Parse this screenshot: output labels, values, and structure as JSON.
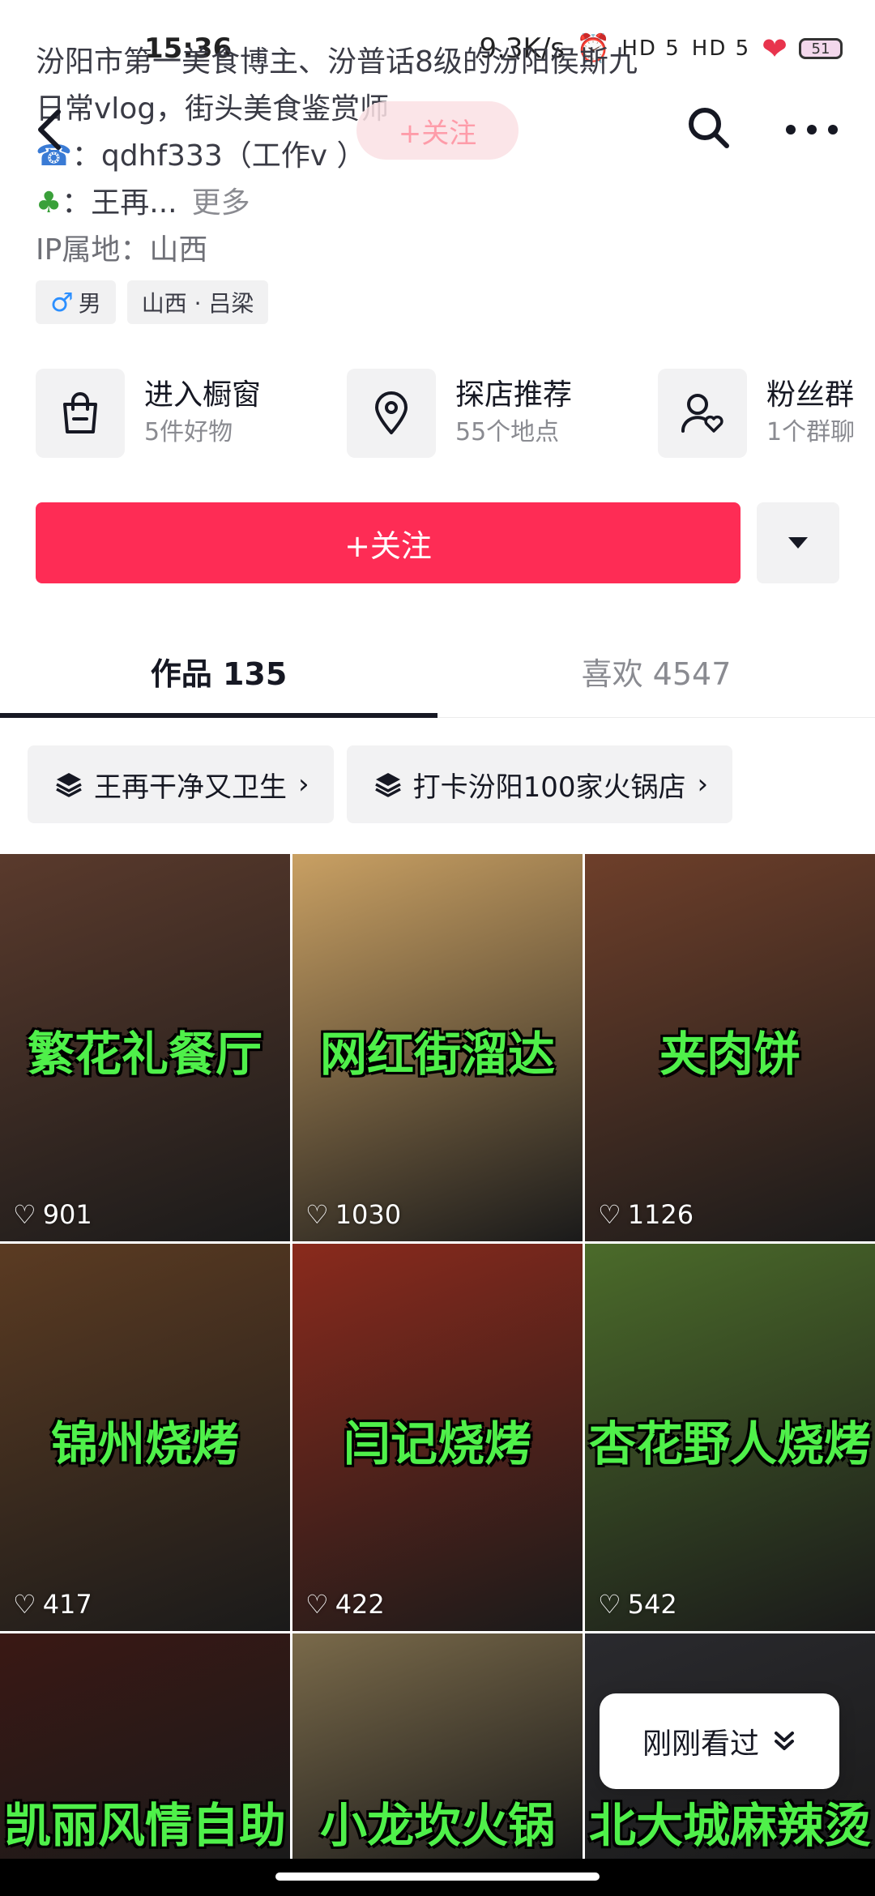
{
  "status_bar": {
    "time": "15:36",
    "network_speed": "9.3K/s",
    "signal_1": "HD 5",
    "signal_2": "HD 5",
    "battery": "51"
  },
  "header": {
    "follow_label": "+关注"
  },
  "bio": {
    "line1": "汾阳市第一美食博主、汾普话8级的汾阳侯斯九",
    "line2": "日常vlog，街头美食鉴赏师",
    "line3": "：qdhf333（工作v ）",
    "line4": "：王再...",
    "more": "更多",
    "ip": "IP属地：山西"
  },
  "tags": {
    "gender": "男",
    "location": "山西 · 吕梁"
  },
  "shortcuts": [
    {
      "title": "进入橱窗",
      "sub": "5件好物",
      "icon": "shopping-bag-icon"
    },
    {
      "title": "探店推荐",
      "sub": "55个地点",
      "icon": "location-pin-icon"
    },
    {
      "title": "粉丝群",
      "sub": "1个群聊",
      "icon": "fan-group-icon"
    }
  ],
  "follow_button": "+关注",
  "tabs": [
    {
      "label": "作品 135"
    },
    {
      "label": "喜欢 4547"
    }
  ],
  "collections": [
    {
      "label": "王再干净又卫生"
    },
    {
      "label": "打卡汾阳100家火锅店"
    }
  ],
  "videos": [
    {
      "caption": "繁花礼餐厅",
      "likes": "901",
      "color": "#5a3a2c"
    },
    {
      "caption": "网红街溜达",
      "likes": "1030",
      "color": "#c9a063"
    },
    {
      "caption": "夹肉饼",
      "likes": "1126",
      "color": "#6e3f2a"
    },
    {
      "caption": "锦州烧烤",
      "likes": "417",
      "color": "#5b3b22"
    },
    {
      "caption": "闫记烧烤",
      "likes": "422",
      "color": "#8a2a1c"
    },
    {
      "caption": "杏花野人烧烤",
      "likes": "542",
      "color": "#4b6b2a"
    },
    {
      "caption": "凯丽风情自助",
      "likes": "",
      "color": "#3a1814"
    },
    {
      "caption": "小龙坎火锅",
      "likes": "",
      "color": "#7a6a4a"
    },
    {
      "caption": "北大城麻辣烫",
      "likes": "",
      "color": "#2a2a2e"
    }
  ],
  "recent_label": "刚刚看过"
}
